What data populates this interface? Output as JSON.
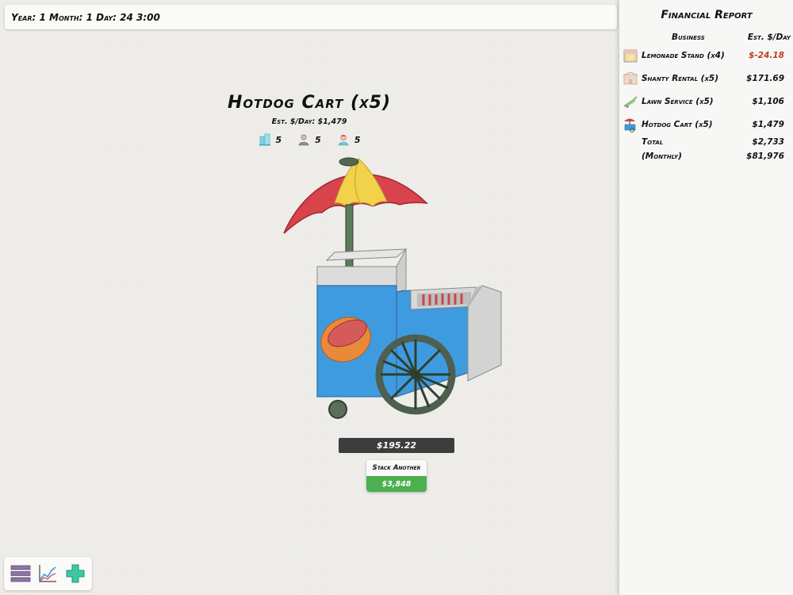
{
  "datebar": {
    "text": "Year: 1 Month: 1 Day: 24 3:00"
  },
  "business": {
    "title": "Hotdog Cart (x5)",
    "est_per_day": "Est. $/Day: $1,479",
    "stats": [
      {
        "icon": "building-icon",
        "value": "5"
      },
      {
        "icon": "worker-icon",
        "value": "5"
      },
      {
        "icon": "customer-icon",
        "value": "5"
      }
    ],
    "current_amount": "$195.22",
    "stack_label": "Stack Another",
    "stack_price": "$3,848"
  },
  "toolbar": {
    "items": [
      {
        "icon": "menu-icon"
      },
      {
        "icon": "chart-icon"
      },
      {
        "icon": "add-icon"
      }
    ]
  },
  "report": {
    "title": "Financial Report",
    "col_business": "Business",
    "col_est": "Est. $/Day",
    "rows": [
      {
        "icon": "lemonade-stand-icon",
        "name": "Lemonade Stand (x4)",
        "value": "$-24.18",
        "negative": true
      },
      {
        "icon": "shanty-icon",
        "name": "Shanty Rental (x5)",
        "value": "$171.69",
        "negative": false
      },
      {
        "icon": "lawn-mower-icon",
        "name": "Lawn Service (x5)",
        "value": "$1,106",
        "negative": false
      },
      {
        "icon": "hotdog-cart-icon",
        "name": "Hotdog Cart (x5)",
        "value": "$1,479",
        "negative": false
      }
    ],
    "total_label": "Total",
    "total_value": "$2,733",
    "monthly_label": "(Monthly)",
    "monthly_value": "$81,976"
  },
  "colors": {
    "positive_button": "#4caf50",
    "negative_value": "#c0392b",
    "price_bar": "#3d3d3d"
  }
}
